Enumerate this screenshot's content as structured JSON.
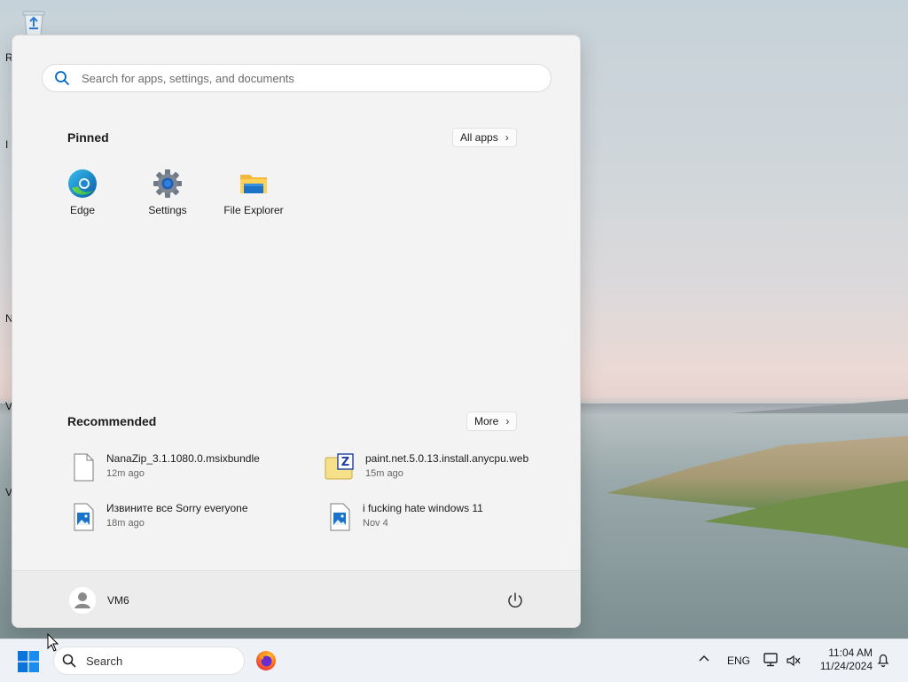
{
  "desktop": {
    "left_fragments": [
      "R",
      "I",
      "N",
      "V",
      "V"
    ]
  },
  "start_menu": {
    "search": {
      "placeholder": "Search for apps, settings, and documents",
      "value": ""
    },
    "pinned": {
      "title": "Pinned",
      "all_apps_label": "All apps",
      "apps": [
        {
          "label": "Edge",
          "icon": "edge-icon"
        },
        {
          "label": "Settings",
          "icon": "settings-gear-icon"
        },
        {
          "label": "File Explorer",
          "icon": "folder-icon"
        }
      ]
    },
    "recommended": {
      "title": "Recommended",
      "more_label": "More",
      "items": [
        {
          "name": "NanaZip_3.1.1080.0.msixbundle",
          "time": "12m ago",
          "icon": "file-icon"
        },
        {
          "name": "paint.net.5.0.13.install.anycpu.web",
          "time": "15m ago",
          "icon": "zip-archive-icon"
        },
        {
          "name": "Извините все Sorry everyone",
          "time": "18m ago",
          "icon": "image-file-icon"
        },
        {
          "name": "i fucking hate windows 11",
          "time": "Nov 4",
          "icon": "image-file-icon"
        }
      ]
    },
    "user": {
      "name": "VM6"
    }
  },
  "taskbar": {
    "search_label": "Search",
    "language": "ENG",
    "time": "11:04 AM",
    "date": "11/24/2024"
  },
  "colors": {
    "accent": "#0067c0",
    "start_bg": "#f3f3f3",
    "taskbar_bg": "#eef2f6"
  }
}
